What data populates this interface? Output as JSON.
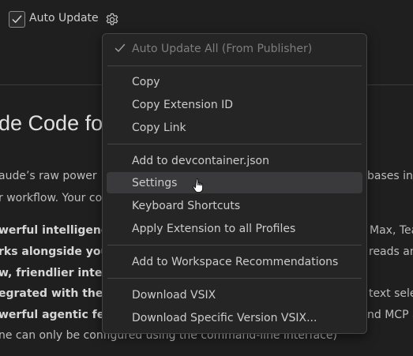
{
  "toolbar": {
    "auto_update_label": "Auto Update",
    "auto_update_checked": true
  },
  "background": {
    "title": "de Code fo",
    "lines": [
      {
        "text": "aude’s raw power",
        "bold": false
      },
      {
        "text": "r workflow. Your co",
        "bold": false
      },
      {
        "text": "werful intelligence",
        "bold": true
      },
      {
        "text": "rks alongside you:",
        "bold": true
      },
      {
        "text": "w, friendlier interf",
        "bold": true
      },
      {
        "text": "egrated with the e",
        "bold": true
      },
      {
        "text": "werful agentic feat",
        "bold": true
      },
      {
        "text": "ne can only be configured using the command-line interface)",
        "bold": false
      }
    ],
    "right_fragments": [
      {
        "text": "bases ins"
      },
      {
        "text": "Max, Team"
      },
      {
        "text": "reads and"
      },
      {
        "text": "text sele"
      },
      {
        "text": "nd MCP a"
      }
    ]
  },
  "menu": {
    "items": [
      {
        "label": "Auto Update All (From Publisher)",
        "disabled": true,
        "checked": true
      },
      {
        "label": "Copy"
      },
      {
        "label": "Copy Extension ID"
      },
      {
        "label": "Copy Link"
      },
      {
        "label": "Add to devcontainer.json"
      },
      {
        "label": "Settings",
        "hovered": true
      },
      {
        "label": "Keyboard Shortcuts"
      },
      {
        "label": "Apply Extension to all Profiles"
      },
      {
        "label": "Add to Workspace Recommendations"
      },
      {
        "label": "Download VSIX"
      },
      {
        "label": "Download Specific Version VSIX..."
      }
    ]
  },
  "icons": {
    "checkbox": "check-icon",
    "gear": "gear-icon",
    "menu_check": "check-icon",
    "cursor": "hand-pointer-cursor-icon"
  }
}
